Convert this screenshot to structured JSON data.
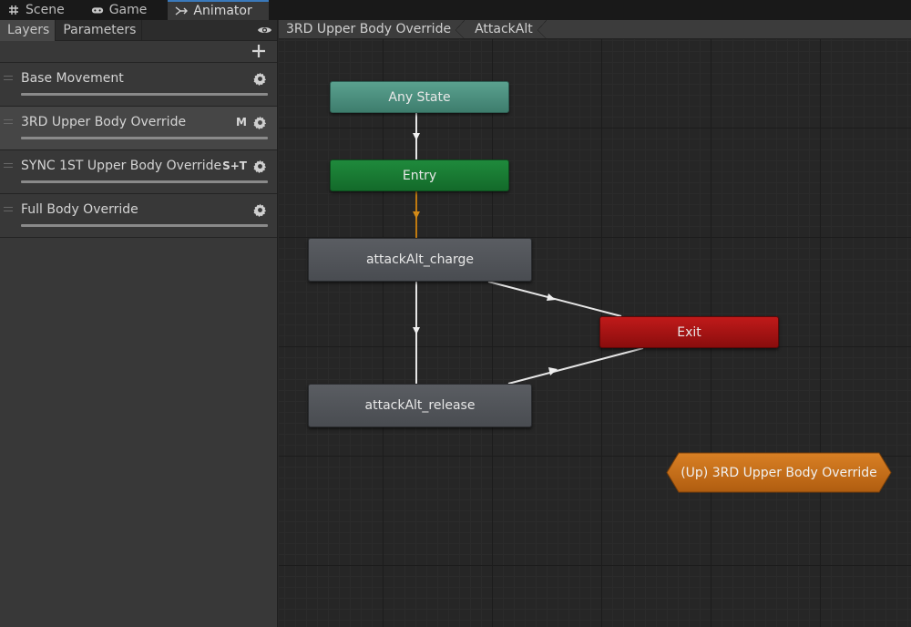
{
  "window_tabs": [
    {
      "label": "Scene",
      "icon": "grid-icon"
    },
    {
      "label": "Game",
      "icon": "gamepad-icon"
    },
    {
      "label": "Animator",
      "icon": "animator-icon",
      "active": true
    }
  ],
  "left_panel": {
    "tabs": [
      {
        "label": "Layers",
        "active": true
      },
      {
        "label": "Parameters"
      }
    ],
    "layers": [
      {
        "name": "Base Movement",
        "badge": "",
        "selected": false
      },
      {
        "name": "3RD Upper Body Override",
        "badge": "M",
        "selected": true
      },
      {
        "name": "SYNC 1ST Upper Body Override",
        "badge": "S+T",
        "selected": false
      },
      {
        "name": "Full Body Override",
        "badge": "",
        "selected": false
      }
    ]
  },
  "breadcrumbs": [
    "3RD Upper Body Override",
    "AttackAlt"
  ],
  "states": {
    "any_state": "Any State",
    "entry": "Entry",
    "charge": "attackAlt_charge",
    "release": "attackAlt_release",
    "exit": "Exit",
    "up": "(Up) 3RD Upper Body Override"
  },
  "colors": {
    "any_state": "#4e9382",
    "entry": "#1a7d36",
    "normal_state": "#52555a",
    "exit": "#a81414",
    "up_node": "#c9701a",
    "default_transition": "#c07a10",
    "tab_accent": "#3a79bb"
  }
}
